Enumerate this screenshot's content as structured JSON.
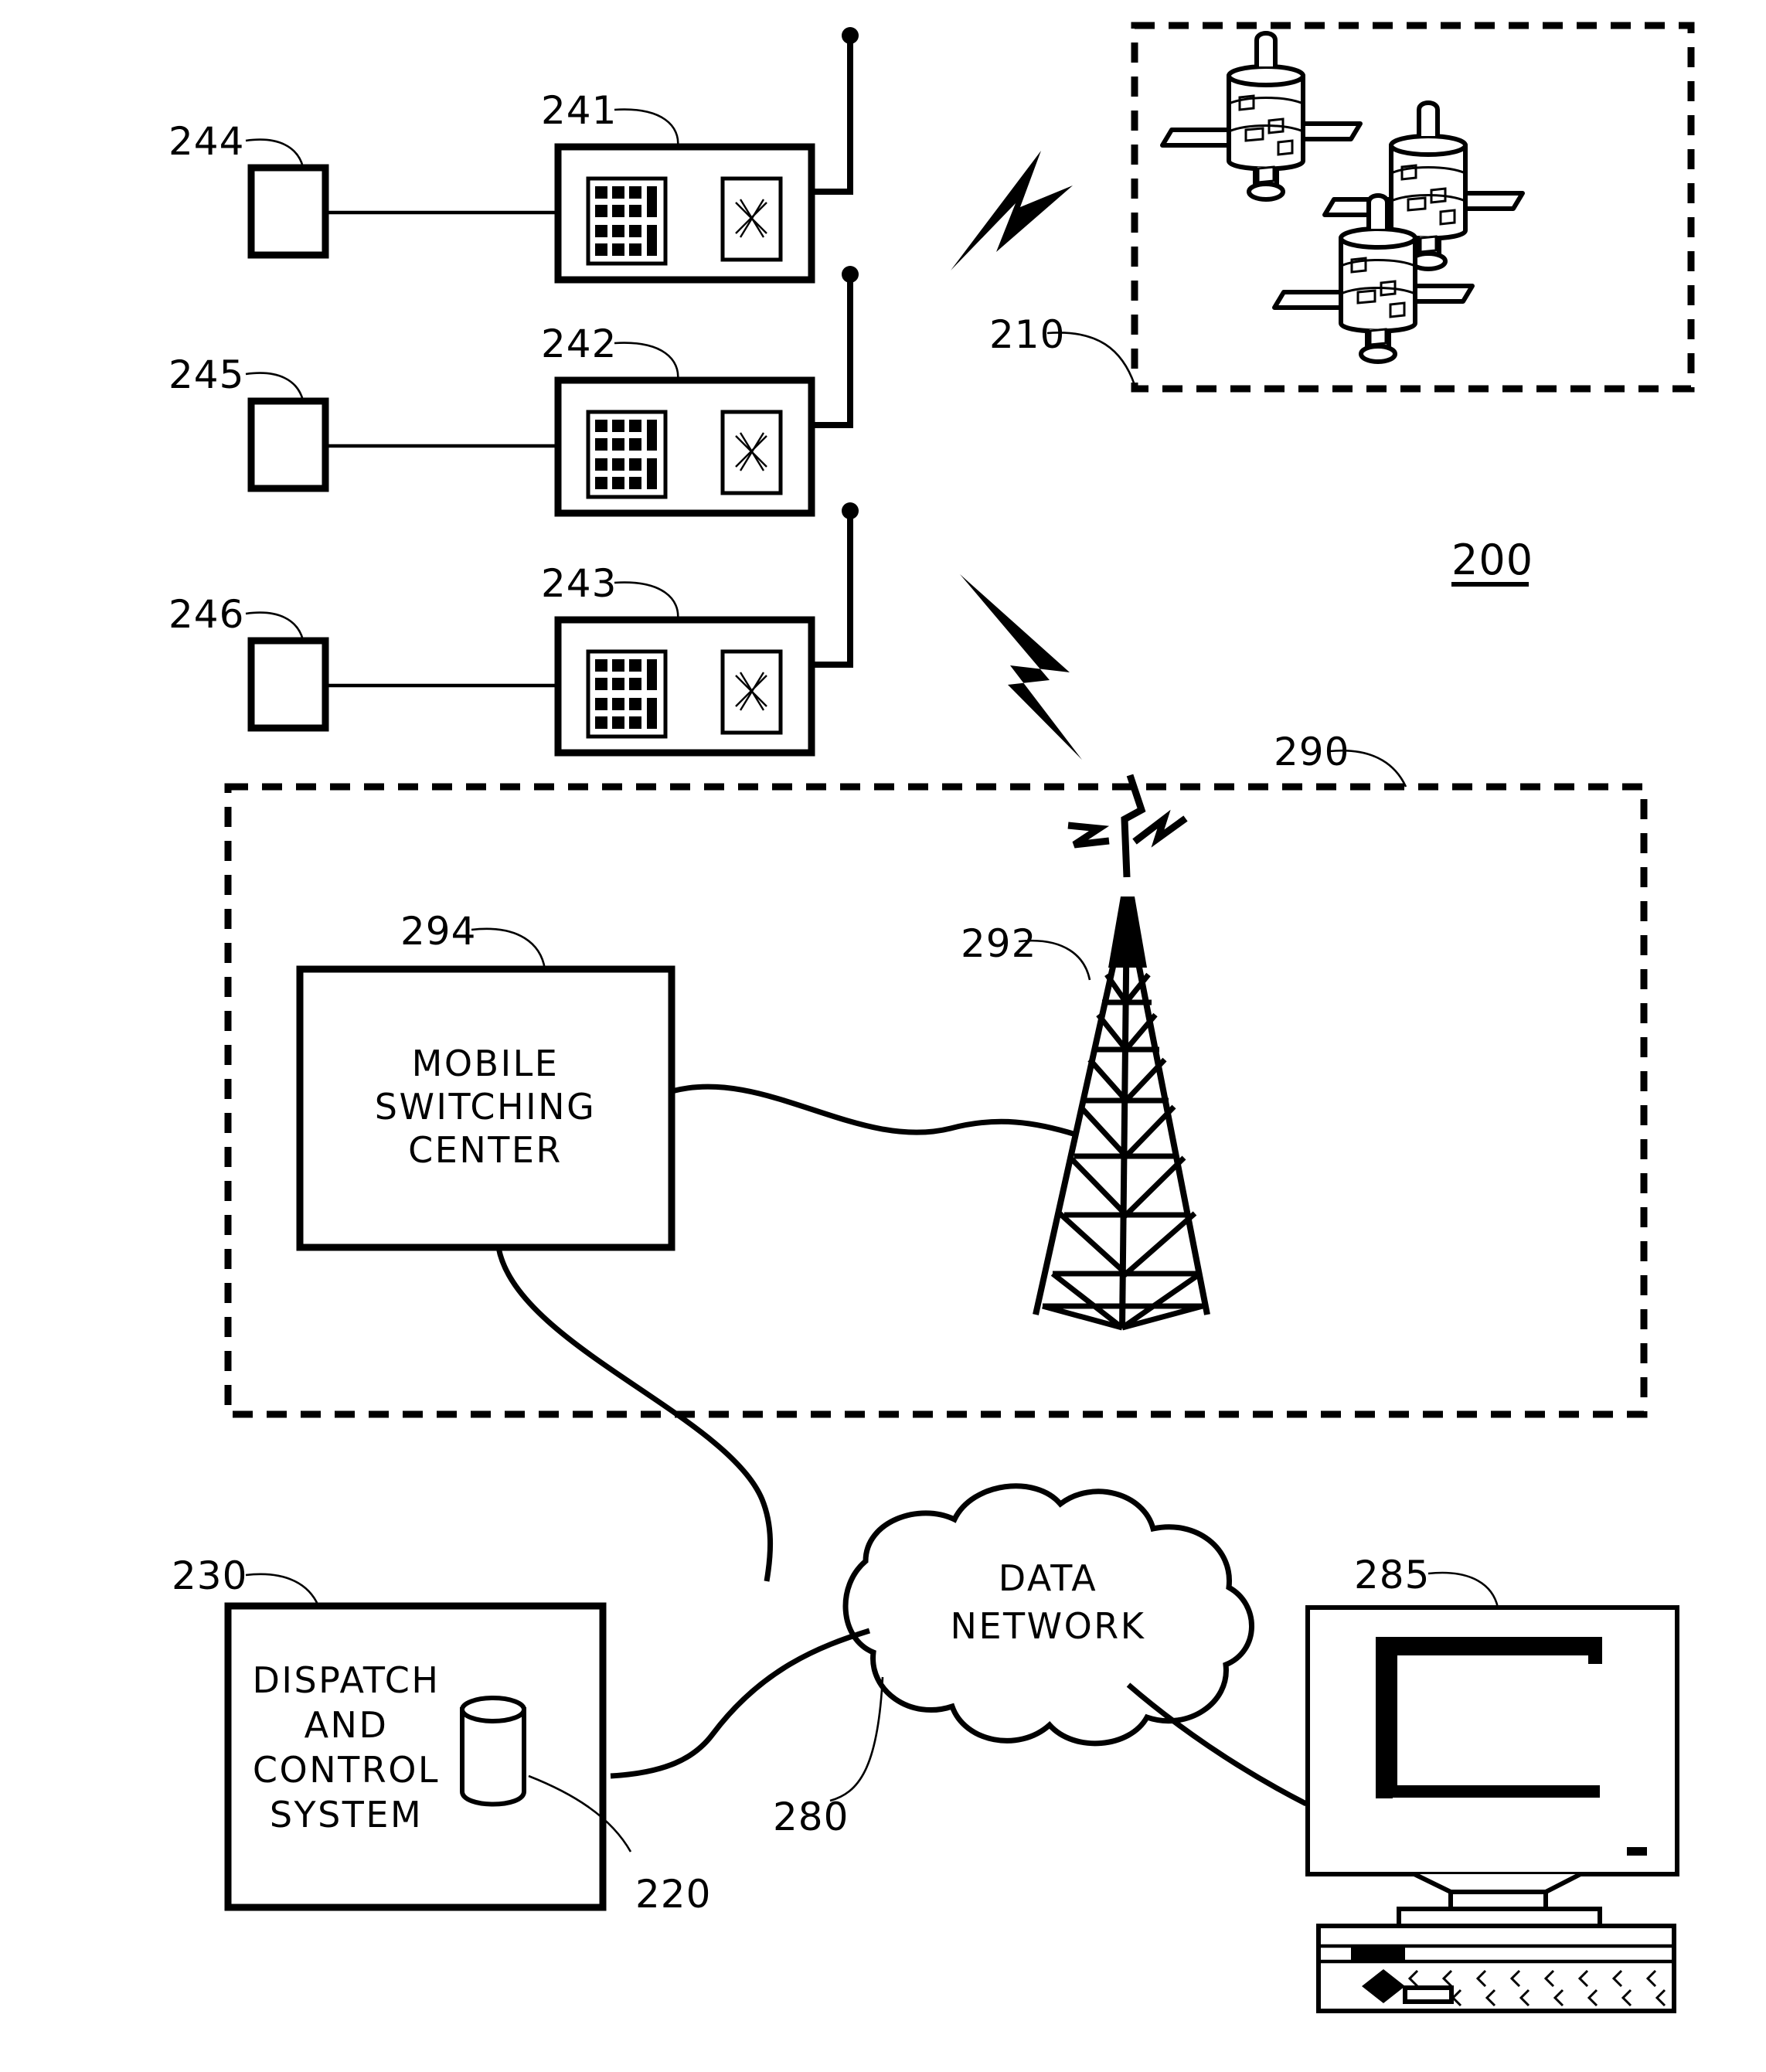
{
  "figure": {
    "number": "200",
    "type": "patent-system-diagram"
  },
  "reference_numerals": {
    "satellite_constellation": "210",
    "database": "220",
    "dispatch_and_control_system": "230",
    "radio_unit_1": "241",
    "radio_unit_2": "242",
    "radio_unit_3": "243",
    "peripheral_1": "244",
    "peripheral_2": "245",
    "peripheral_3": "246",
    "data_network": "280",
    "workstation": "285",
    "wireless_network": "290",
    "cell_tower": "292",
    "mobile_switching_center": "294",
    "figure_id": "200"
  },
  "labels": {
    "mobile_switching_center": [
      "MOBILE",
      "SWITCHING",
      "CENTER"
    ],
    "dispatch_and_control_system": [
      "DISPATCH",
      "AND",
      "CONTROL",
      "SYSTEM"
    ],
    "data_network": [
      "DATA",
      "NETWORK"
    ]
  },
  "radio_units": [
    {
      "ref": "241",
      "keypad_rows": 4,
      "keypad_cols": 3,
      "side_bars": 2,
      "display": "x-pattern"
    },
    {
      "ref": "242",
      "keypad_rows": 4,
      "keypad_cols": 3,
      "side_bars": 2,
      "display": "x-pattern"
    },
    {
      "ref": "243",
      "keypad_rows": 4,
      "keypad_cols": 3,
      "side_bars": 2,
      "display": "x-pattern"
    }
  ],
  "peripherals": [
    {
      "ref": "244"
    },
    {
      "ref": "245"
    },
    {
      "ref": "246"
    }
  ],
  "satellites": {
    "count": 3,
    "container_ref": "210",
    "border": "dashed"
  },
  "icons": {
    "satellite": "satellite-icon",
    "lightning_upper": "lightning-bolt-icon",
    "lightning_lower": "lightning-bolt-icon",
    "tower": "cell-tower-icon",
    "cloud": "network-cloud-icon",
    "database": "database-cylinder-icon",
    "monitor": "crt-monitor-icon",
    "keyboard": "keyboard-icon",
    "keypad": "keypad-icon",
    "display": "radio-display-icon",
    "antenna": "antenna-icon"
  },
  "colors": {
    "ink": "#000000",
    "paper": "#ffffff"
  }
}
